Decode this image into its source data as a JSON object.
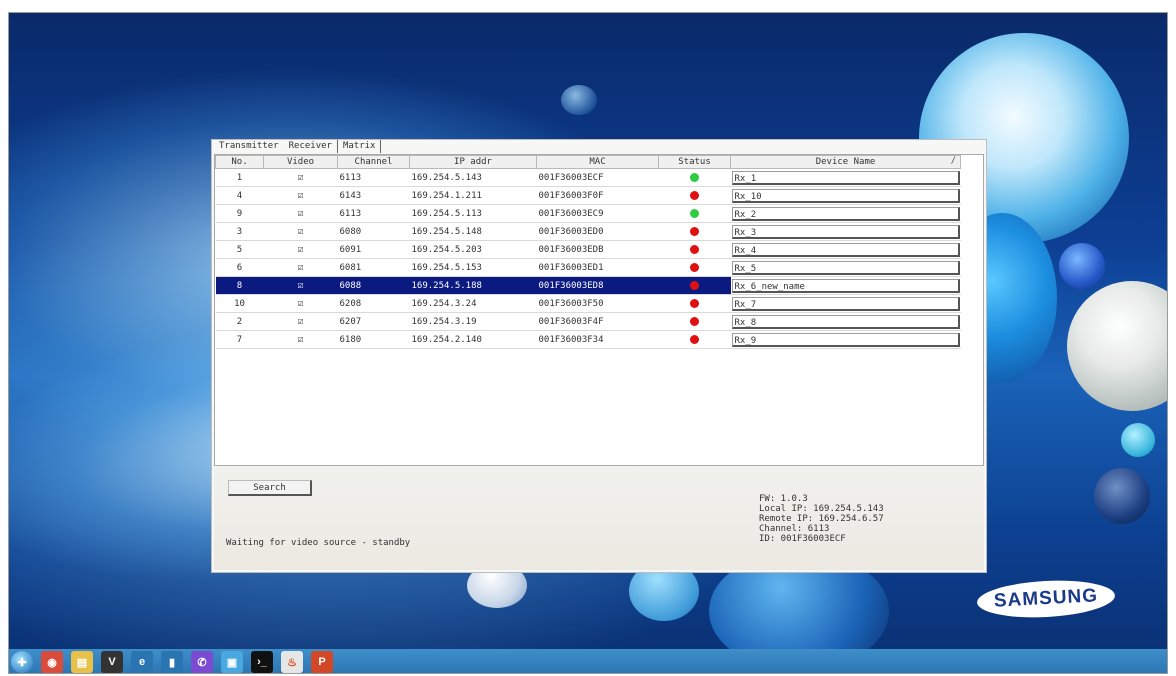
{
  "tabs": [
    {
      "label": "Transmitter"
    },
    {
      "label": "Receiver"
    },
    {
      "label": "Matrix"
    }
  ],
  "table": {
    "columns": [
      "No.",
      "Video",
      "Channel",
      "IP addr",
      "MAC",
      "Status",
      "Device Name"
    ],
    "column_end_mark": "/",
    "rows": [
      {
        "no": "1",
        "video": "☑",
        "channel": "6113",
        "ip": "169.254.5.143",
        "mac": "001F36003ECF",
        "status": "green",
        "name": "Rx_1"
      },
      {
        "no": "4",
        "video": "☑",
        "channel": "6143",
        "ip": "169.254.1.211",
        "mac": "001F36003F0F",
        "status": "red",
        "name": "Rx_10"
      },
      {
        "no": "9",
        "video": "☑",
        "channel": "6113",
        "ip": "169.254.5.113",
        "mac": "001F36003EC9",
        "status": "green",
        "name": "Rx_2"
      },
      {
        "no": "3",
        "video": "☑",
        "channel": "6080",
        "ip": "169.254.5.148",
        "mac": "001F36003ED0",
        "status": "red",
        "name": "Rx_3"
      },
      {
        "no": "5",
        "video": "☑",
        "channel": "6091",
        "ip": "169.254.5.203",
        "mac": "001F36003EDB",
        "status": "red",
        "name": "Rx_4"
      },
      {
        "no": "6",
        "video": "☑",
        "channel": "6081",
        "ip": "169.254.5.153",
        "mac": "001F36003ED1",
        "status": "red",
        "name": "Rx_5"
      },
      {
        "no": "8",
        "video": "☑",
        "channel": "6088",
        "ip": "169.254.5.188",
        "mac": "001F36003ED8",
        "status": "red",
        "name": "Rx_6_new_name",
        "selected": true
      },
      {
        "no": "10",
        "video": "☑",
        "channel": "6208",
        "ip": "169.254.3.24",
        "mac": "001F36003F50",
        "status": "red",
        "name": "Rx_7"
      },
      {
        "no": "2",
        "video": "☑",
        "channel": "6207",
        "ip": "169.254.3.19",
        "mac": "001F36003F4F",
        "status": "red",
        "name": "Rx_8"
      },
      {
        "no": "7",
        "video": "☑",
        "channel": "6180",
        "ip": "169.254.2.140",
        "mac": "001F36003F34",
        "status": "red",
        "name": "Rx_9"
      }
    ]
  },
  "search_label": "Search",
  "status_message": "Waiting for video source - standby",
  "info": {
    "fw": "FW: 1.0.3",
    "local_ip": "Local IP: 169.254.5.143",
    "remote_ip": "Remote IP: 169.254.6.57",
    "channel": "Channel: 6113",
    "id": "ID: 001F36003ECF"
  },
  "brand": "SAMSUNG",
  "colors": {
    "status_green": "#2ecc40",
    "status_red": "#e01010",
    "selection": "#0b1a80"
  },
  "taskbar": [
    {
      "name": "start-button-icon",
      "glyph": "✚",
      "bg": "#3aa0e0"
    },
    {
      "name": "chrome-icon",
      "glyph": "◉",
      "bg": "#d94b3a"
    },
    {
      "name": "file-explorer-icon",
      "glyph": "▤",
      "bg": "#e8c14a"
    },
    {
      "name": "vnc-icon",
      "glyph": "V",
      "bg": "#333333"
    },
    {
      "name": "internet-explorer-icon",
      "glyph": "e",
      "bg": "#2b74b2"
    },
    {
      "name": "document-icon",
      "glyph": "▮",
      "bg": "#2b74b2"
    },
    {
      "name": "viber-icon",
      "glyph": "✆",
      "bg": "#7b4bd1"
    },
    {
      "name": "remote-desktop-icon",
      "glyph": "▣",
      "bg": "#4aa8e0"
    },
    {
      "name": "command-prompt-icon",
      "glyph": "›_",
      "bg": "#111111"
    },
    {
      "name": "java-icon",
      "glyph": "♨",
      "bg": "#e6e6e6"
    },
    {
      "name": "powerpoint-icon",
      "glyph": "P",
      "bg": "#d24726"
    }
  ]
}
